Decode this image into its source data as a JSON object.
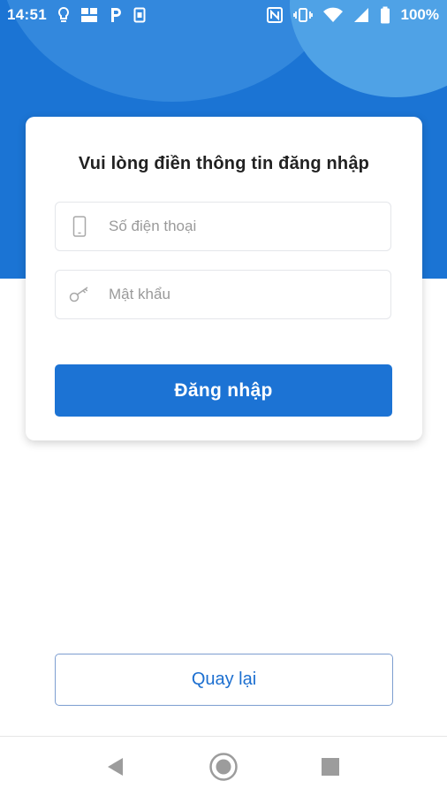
{
  "status_bar": {
    "time": "14:51",
    "left_icons": [
      "lightbulb-icon",
      "gallery-icon",
      "parking-icon",
      "sim-icon"
    ],
    "right_icons": [
      "nfc-icon",
      "vibrate-icon",
      "wifi-icon",
      "signal-icon",
      "battery-icon"
    ],
    "battery_text": "100%"
  },
  "login": {
    "title": "Vui lòng điền thông tin đăng nhập",
    "phone_placeholder": "Số điện thoại",
    "phone_icon": "phone-icon",
    "password_placeholder": "Mật khẩu",
    "password_icon": "key-icon",
    "submit_label": "Đăng nhập"
  },
  "back_label": "Quay lại",
  "nav_bar": {
    "buttons": [
      "back-triangle-icon",
      "home-circle-icon",
      "recents-square-icon"
    ]
  },
  "colors": {
    "primary": "#1c73d4",
    "header_bg": "#1b74d4",
    "bubble_light": "#4fa2e6",
    "outline_button_border": "#7d9ed0"
  }
}
